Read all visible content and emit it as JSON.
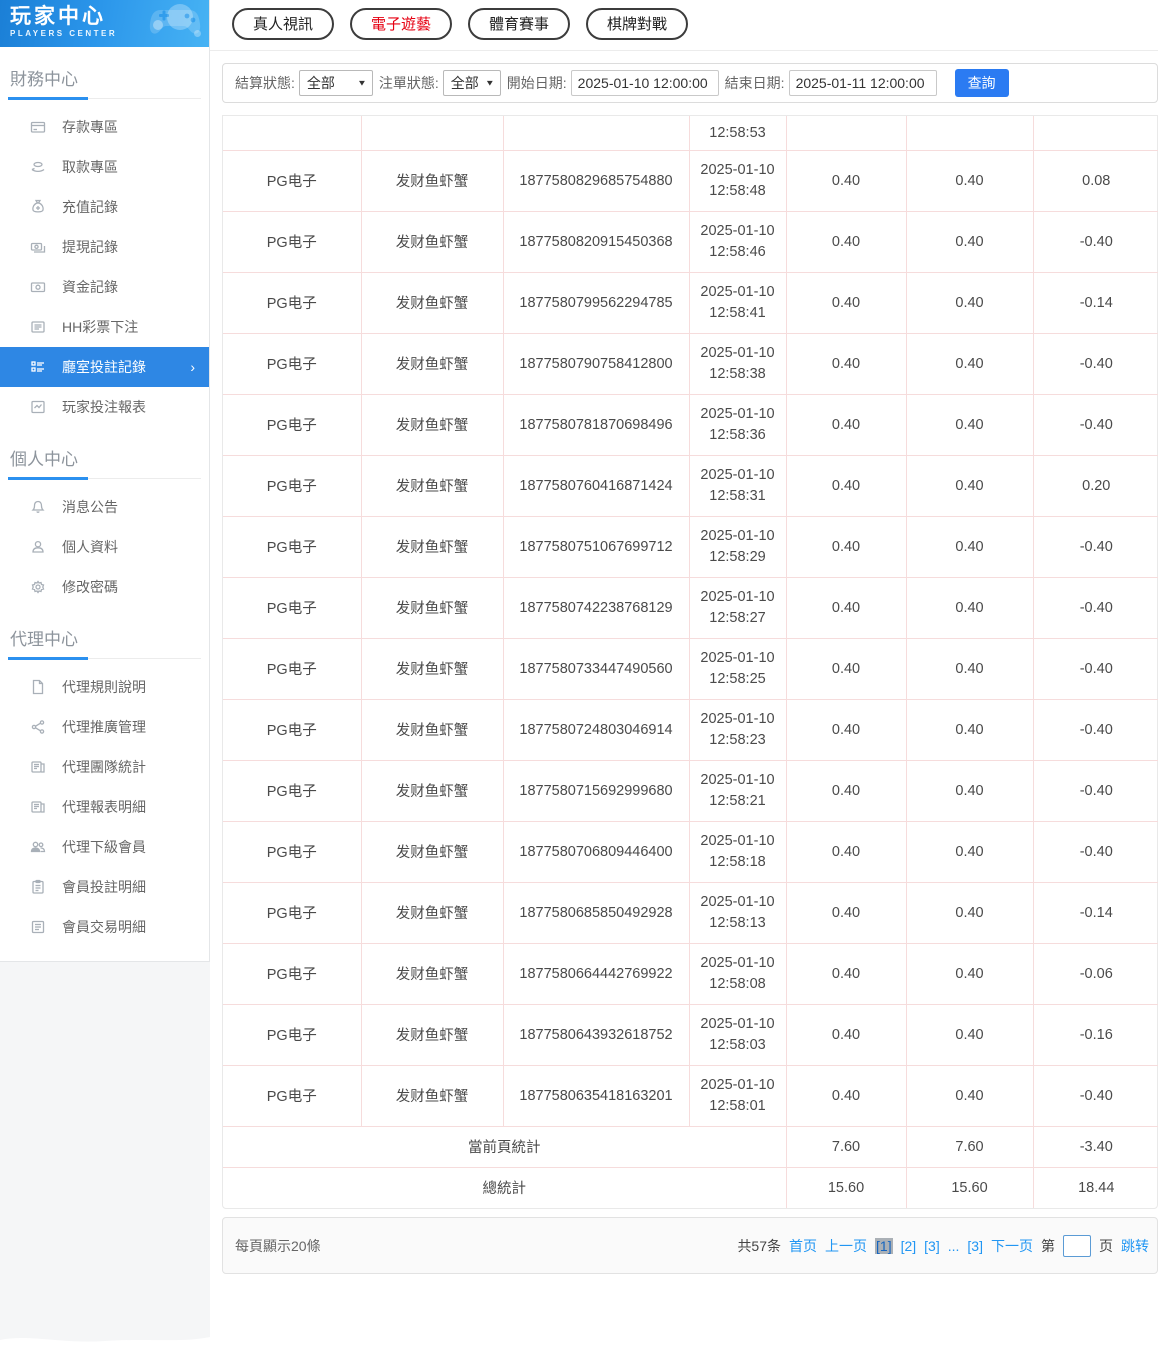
{
  "sidebar": {
    "logo": {
      "title": "玩家中心",
      "subtitle": "PLAYERS CENTER"
    },
    "sections": [
      {
        "title": "財務中心",
        "items": [
          {
            "label": "存款專區",
            "icon": "deposit-icon",
            "active": false
          },
          {
            "label": "取款專區",
            "icon": "withdraw-icon",
            "active": false
          },
          {
            "label": "充值記錄",
            "icon": "recharge-icon",
            "active": false
          },
          {
            "label": "提現記錄",
            "icon": "cashout-icon",
            "active": false
          },
          {
            "label": "資金記錄",
            "icon": "funds-icon",
            "active": false
          },
          {
            "label": "HH彩票下注",
            "icon": "lottery-icon",
            "active": false
          },
          {
            "label": "廳室投註記錄",
            "icon": "bet-record-icon",
            "active": true,
            "chevron": "›"
          },
          {
            "label": "玩家投注報表",
            "icon": "player-report-icon",
            "active": false
          }
        ]
      },
      {
        "title": "個人中心",
        "items": [
          {
            "label": "消息公告",
            "icon": "bell-icon",
            "active": false
          },
          {
            "label": "個人資料",
            "icon": "user-icon",
            "active": false
          },
          {
            "label": "修改密碼",
            "icon": "gear-icon",
            "active": false
          }
        ]
      },
      {
        "title": "代理中心",
        "items": [
          {
            "label": "代理規則說明",
            "icon": "document-icon",
            "active": false
          },
          {
            "label": "代理推廣管理",
            "icon": "share-icon",
            "active": false
          },
          {
            "label": "代理團隊統計",
            "icon": "team-stats-icon",
            "active": false
          },
          {
            "label": "代理報表明細",
            "icon": "report-detail-icon",
            "active": false
          },
          {
            "label": "代理下級會員",
            "icon": "users-icon",
            "active": false
          },
          {
            "label": "會員投註明細",
            "icon": "member-bets-icon",
            "active": false
          },
          {
            "label": "會員交易明細",
            "icon": "member-trans-icon",
            "active": false
          }
        ]
      }
    ]
  },
  "tabs": [
    {
      "label": "真人視訊",
      "active": false
    },
    {
      "label": "電子遊藝",
      "active": true
    },
    {
      "label": "體育賽事",
      "active": false
    },
    {
      "label": "棋牌對戰",
      "active": false
    }
  ],
  "filters": {
    "settle_status_label": "結算狀態:",
    "settle_status_value": "全部",
    "order_status_label": "注單狀態:",
    "order_status_value": "全部",
    "start_date_label": "開始日期:",
    "start_date_value": "2025-01-10 12:00:00",
    "end_date_label": "結束日期:",
    "end_date_value": "2025-01-11 12:00:00",
    "search_button": "查詢"
  },
  "table": {
    "partial_row_time": "12:58:53",
    "rows": [
      {
        "platform": "PG电子",
        "game": "发财鱼虾蟹",
        "order": "1877580829685754880",
        "date": "2025-01-10",
        "time": "12:58:48",
        "bet": "0.40",
        "valid": "0.40",
        "profit": "0.08"
      },
      {
        "platform": "PG电子",
        "game": "发财鱼虾蟹",
        "order": "1877580820915450368",
        "date": "2025-01-10",
        "time": "12:58:46",
        "bet": "0.40",
        "valid": "0.40",
        "profit": "-0.40"
      },
      {
        "platform": "PG电子",
        "game": "发财鱼虾蟹",
        "order": "1877580799562294785",
        "date": "2025-01-10",
        "time": "12:58:41",
        "bet": "0.40",
        "valid": "0.40",
        "profit": "-0.14"
      },
      {
        "platform": "PG电子",
        "game": "发财鱼虾蟹",
        "order": "1877580790758412800",
        "date": "2025-01-10",
        "time": "12:58:38",
        "bet": "0.40",
        "valid": "0.40",
        "profit": "-0.40"
      },
      {
        "platform": "PG电子",
        "game": "发财鱼虾蟹",
        "order": "1877580781870698496",
        "date": "2025-01-10",
        "time": "12:58:36",
        "bet": "0.40",
        "valid": "0.40",
        "profit": "-0.40"
      },
      {
        "platform": "PG电子",
        "game": "发财鱼虾蟹",
        "order": "1877580760416871424",
        "date": "2025-01-10",
        "time": "12:58:31",
        "bet": "0.40",
        "valid": "0.40",
        "profit": "0.20"
      },
      {
        "platform": "PG电子",
        "game": "发财鱼虾蟹",
        "order": "1877580751067699712",
        "date": "2025-01-10",
        "time": "12:58:29",
        "bet": "0.40",
        "valid": "0.40",
        "profit": "-0.40"
      },
      {
        "platform": "PG电子",
        "game": "发财鱼虾蟹",
        "order": "1877580742238768129",
        "date": "2025-01-10",
        "time": "12:58:27",
        "bet": "0.40",
        "valid": "0.40",
        "profit": "-0.40"
      },
      {
        "platform": "PG电子",
        "game": "发财鱼虾蟹",
        "order": "1877580733447490560",
        "date": "2025-01-10",
        "time": "12:58:25",
        "bet": "0.40",
        "valid": "0.40",
        "profit": "-0.40"
      },
      {
        "platform": "PG电子",
        "game": "发财鱼虾蟹",
        "order": "1877580724803046914",
        "date": "2025-01-10",
        "time": "12:58:23",
        "bet": "0.40",
        "valid": "0.40",
        "profit": "-0.40"
      },
      {
        "platform": "PG电子",
        "game": "发财鱼虾蟹",
        "order": "1877580715692999680",
        "date": "2025-01-10",
        "time": "12:58:21",
        "bet": "0.40",
        "valid": "0.40",
        "profit": "-0.40"
      },
      {
        "platform": "PG电子",
        "game": "发财鱼虾蟹",
        "order": "1877580706809446400",
        "date": "2025-01-10",
        "time": "12:58:18",
        "bet": "0.40",
        "valid": "0.40",
        "profit": "-0.40"
      },
      {
        "platform": "PG电子",
        "game": "发财鱼虾蟹",
        "order": "1877580685850492928",
        "date": "2025-01-10",
        "time": "12:58:13",
        "bet": "0.40",
        "valid": "0.40",
        "profit": "-0.14"
      },
      {
        "platform": "PG电子",
        "game": "发财鱼虾蟹",
        "order": "1877580664442769922",
        "date": "2025-01-10",
        "time": "12:58:08",
        "bet": "0.40",
        "valid": "0.40",
        "profit": "-0.06"
      },
      {
        "platform": "PG电子",
        "game": "发财鱼虾蟹",
        "order": "1877580643932618752",
        "date": "2025-01-10",
        "time": "12:58:03",
        "bet": "0.40",
        "valid": "0.40",
        "profit": "-0.16"
      },
      {
        "platform": "PG电子",
        "game": "发财鱼虾蟹",
        "order": "1877580635418163201",
        "date": "2025-01-10",
        "time": "12:58:01",
        "bet": "0.40",
        "valid": "0.40",
        "profit": "-0.40"
      }
    ],
    "summary": [
      {
        "label": "當前頁統計",
        "bet": "7.60",
        "valid": "7.60",
        "profit": "-3.40"
      },
      {
        "label": "總統計",
        "bet": "15.60",
        "valid": "15.60",
        "profit": "18.44"
      }
    ]
  },
  "pagination": {
    "page_size_text": "每頁顯示20條",
    "total_text": "共57条",
    "first": "首页",
    "prev": "上一页",
    "pages": [
      "[1]",
      "[2]",
      "[3]",
      "...",
      "[3]"
    ],
    "current_page_index": 0,
    "next": "下一页",
    "jump_prefix": "第",
    "jump_suffix": "页",
    "jump_action": "跳转"
  },
  "colors": {
    "accent_blue": "#2e87e4",
    "tab_active_red": "#e60012",
    "link_blue": "#2196f3",
    "table_border_pink": "#f6dcdc"
  }
}
